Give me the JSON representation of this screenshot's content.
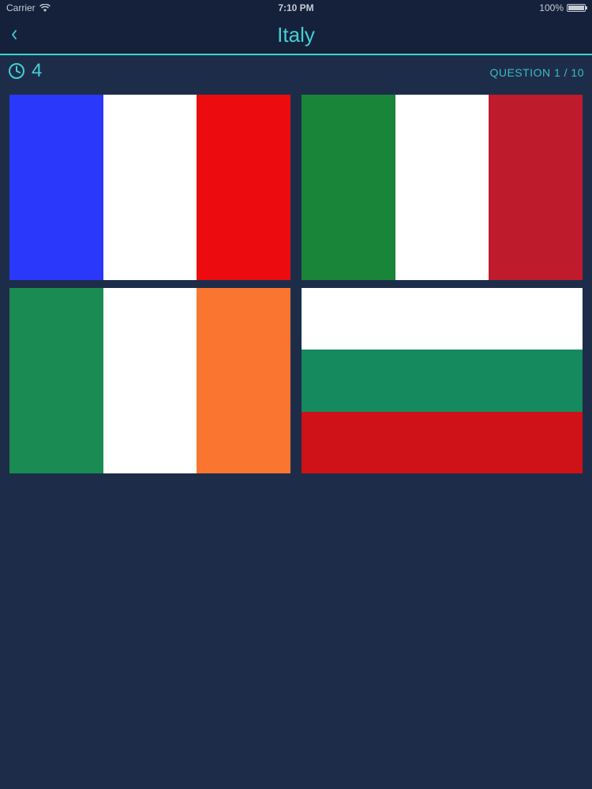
{
  "status_bar": {
    "carrier": "Carrier",
    "time": "7:10 PM",
    "battery": "100%",
    "battery_level": 1.0
  },
  "nav": {
    "title": "Italy"
  },
  "timer": {
    "value": "4"
  },
  "question_counter": "QUESTION 1 / 10",
  "colors": {
    "accent": "#45cfd3",
    "background": "#1d2d49",
    "nav_background": "#15213a"
  },
  "flags": [
    {
      "orientation": "vertical",
      "stripes": [
        "#2a38fb",
        "#ffffff",
        "#ec0b0f"
      ]
    },
    {
      "orientation": "vertical",
      "stripes": [
        "#188539",
        "#ffffff",
        "#be1b2c"
      ]
    },
    {
      "orientation": "vertical",
      "stripes": [
        "#1b8b54",
        "#ffffff",
        "#fa7630"
      ]
    },
    {
      "orientation": "horizontal",
      "stripes": [
        "#ffffff",
        "#158a5e",
        "#cf1218"
      ]
    }
  ]
}
